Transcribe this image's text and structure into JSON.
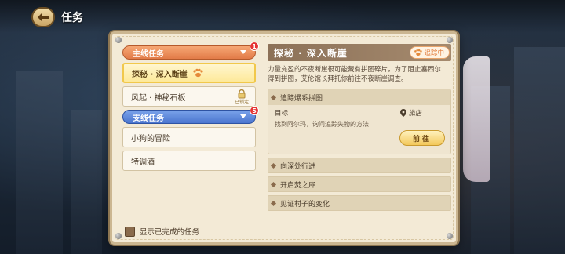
{
  "header": {
    "title": "任务"
  },
  "left": {
    "main_category": {
      "label": "主线任务",
      "badge": "1"
    },
    "main_quests": [
      {
        "label": "探秘 · 深入断崖",
        "active": true
      },
      {
        "label": "风起 · 神秘石板",
        "locked": true,
        "lock_label": "已锁定"
      }
    ],
    "side_category": {
      "label": "支线任务",
      "badge": "5"
    },
    "side_quests": [
      {
        "label": "小狗的冒险"
      },
      {
        "label": "特调酒"
      }
    ],
    "show_completed_label": "显示已完成的任务"
  },
  "detail": {
    "title": "探秘 · 深入断崖",
    "tracking_label": "追踪中",
    "description": "力量充盈的不夜断崖很可能藏有拼图碎片，为了阻止塞西尔得到拼图，艾伦馆长拜托你前往不夜断崖调查。",
    "current_step": {
      "title": "追踪爆系拼图",
      "goal_label": "目标",
      "location": "旅店",
      "goal_text": "找到阿尔玛，询问追踪失物的方法",
      "go_label": "前往"
    },
    "steps": [
      "向深处行进",
      "开启焚之扉",
      "见证村子的变化"
    ]
  },
  "colors": {
    "accent_orange": "#e27b48",
    "accent_blue": "#4a75cf",
    "badge_red": "#e53434",
    "parchment": "#f3ead6"
  }
}
